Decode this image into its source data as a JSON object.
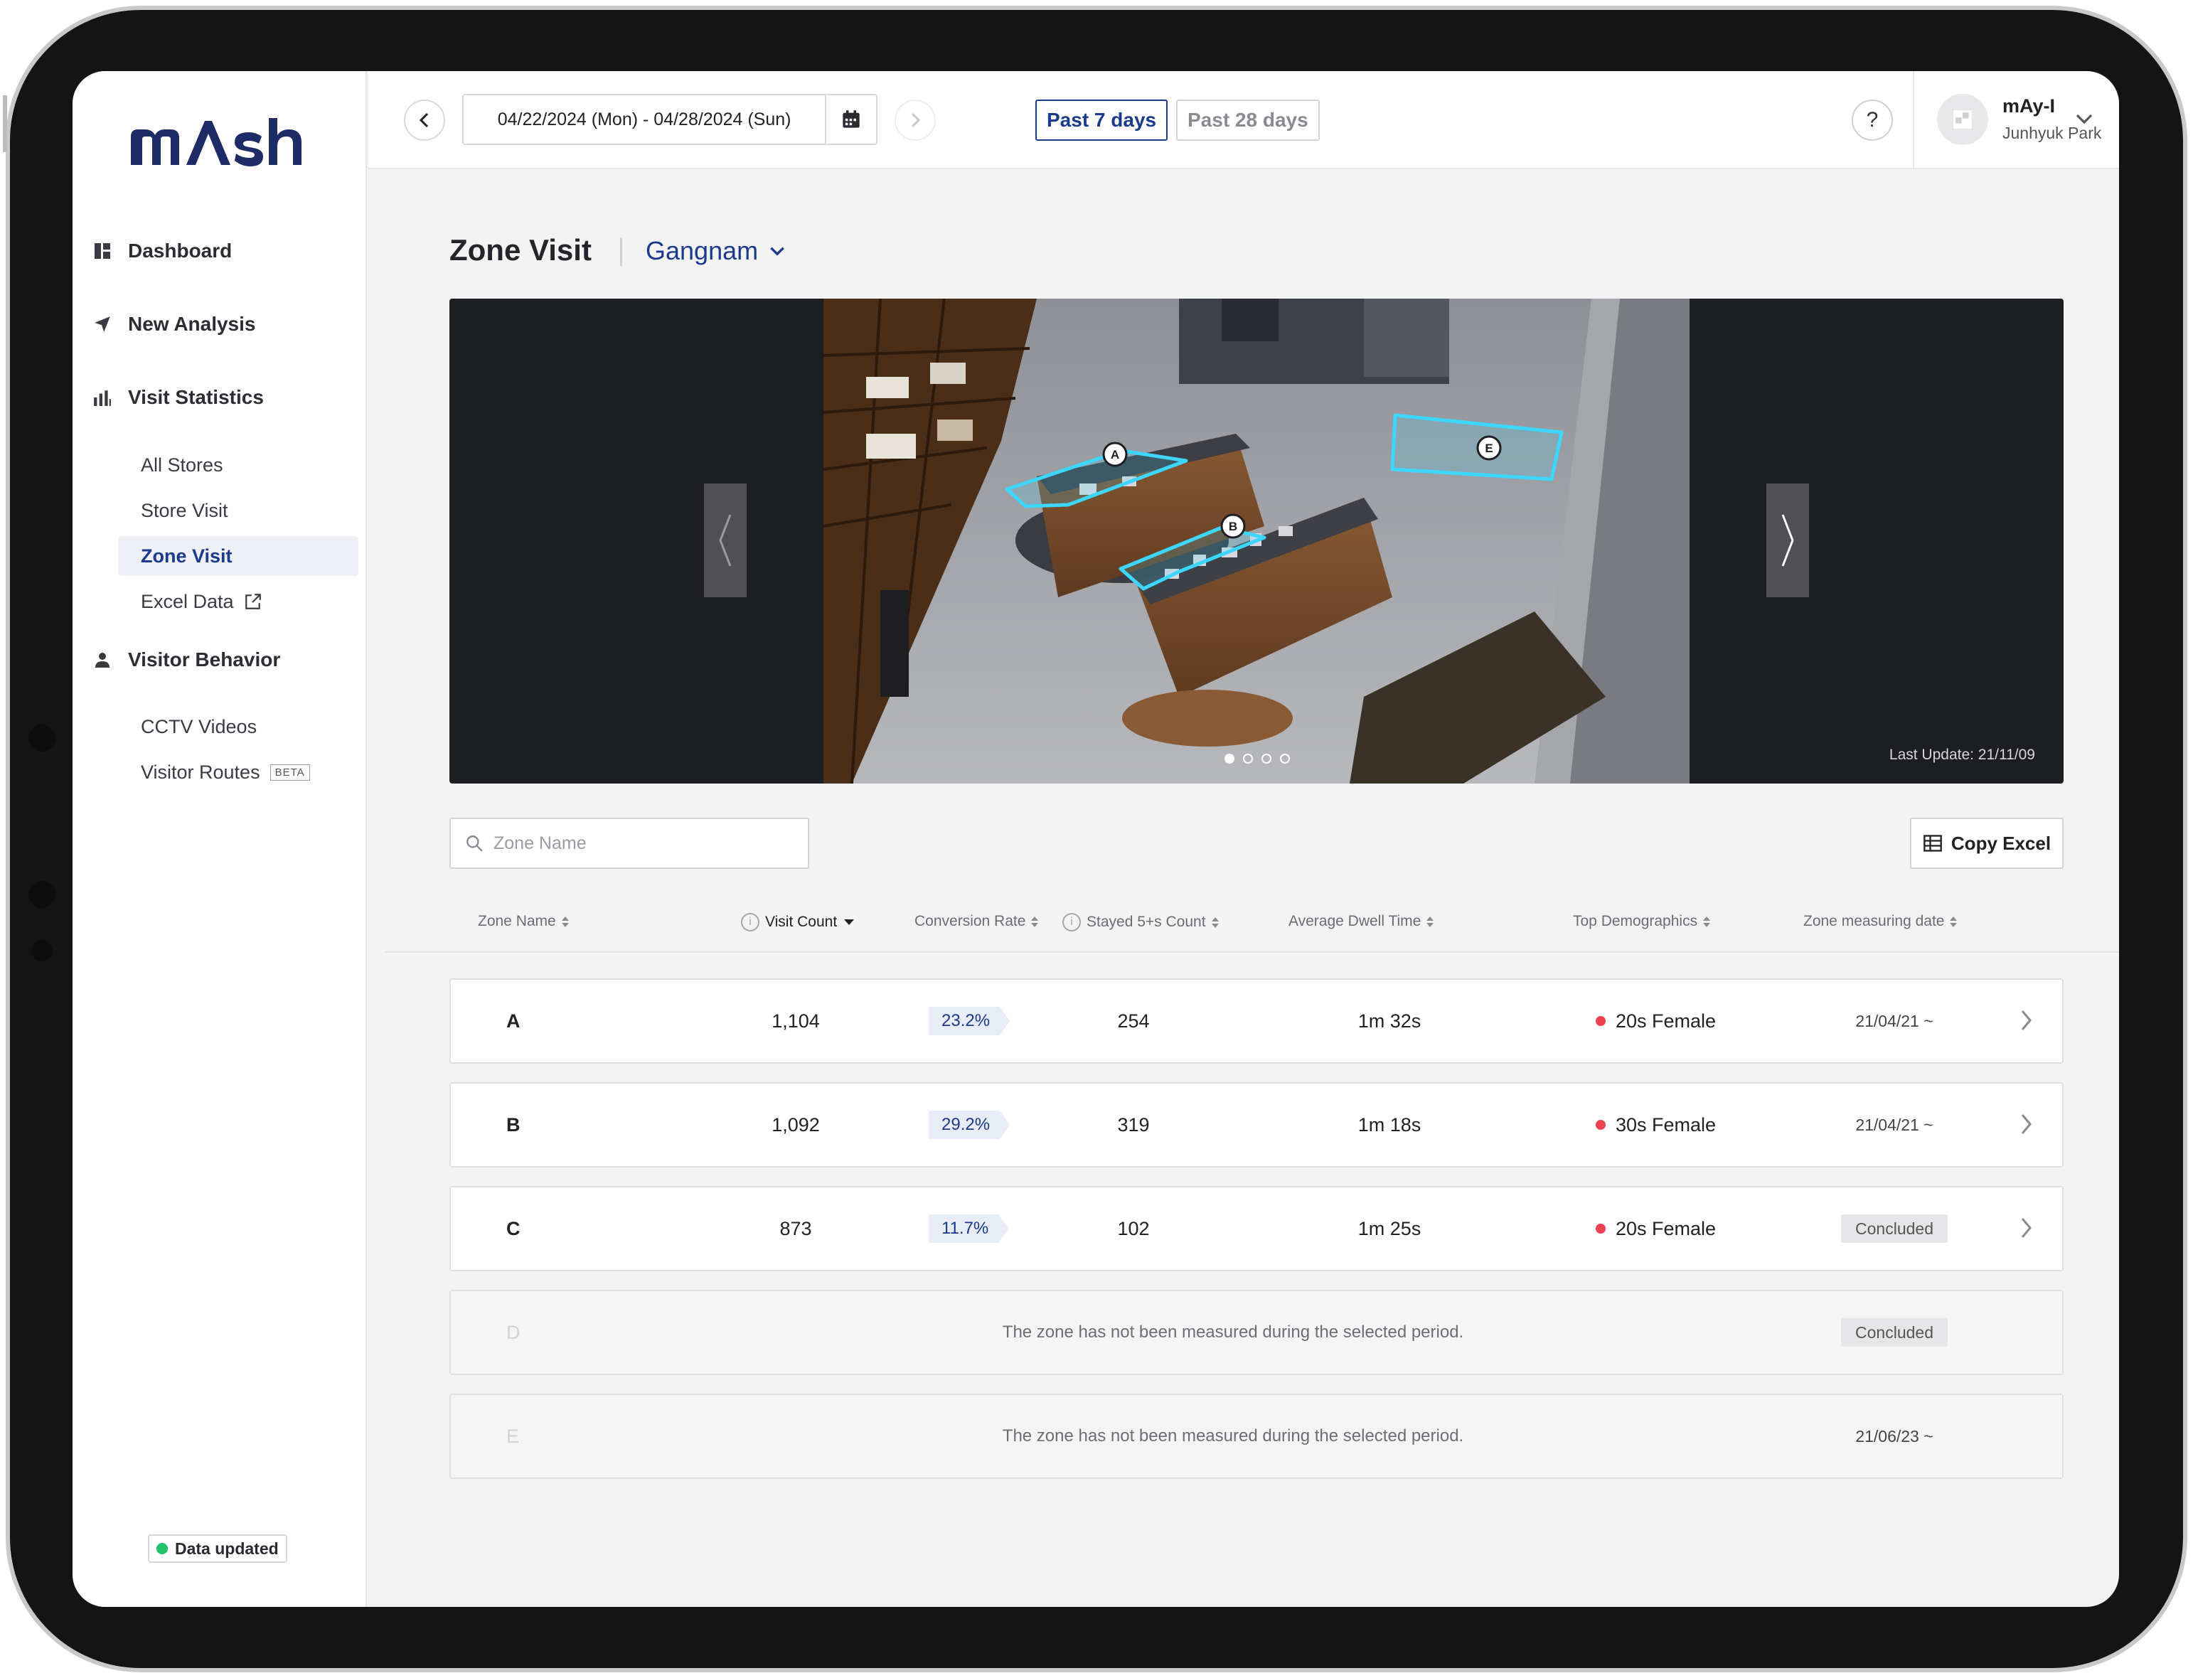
{
  "brand": {
    "logo_text": "mAsh"
  },
  "sidebar": {
    "main_items": [
      {
        "label": "Dashboard",
        "icon": "dashboard-icon"
      },
      {
        "label": "New Analysis",
        "icon": "send-icon"
      },
      {
        "label": "Visit Statistics",
        "icon": "bar-chart-icon"
      },
      {
        "label": "Visitor Behavior",
        "icon": "person-icon"
      }
    ],
    "sub_items": [
      {
        "label": "All Stores"
      },
      {
        "label": "Store Visit"
      },
      {
        "label": "Zone Visit",
        "active": true
      },
      {
        "label": "Excel Data",
        "icon": "external-link-icon"
      },
      {
        "label": "CCTV Videos"
      },
      {
        "label": "Visitor Routes",
        "badge": "BETA"
      }
    ],
    "status": "Data updated"
  },
  "topbar": {
    "date_range": "04/22/2024 (Mon) - 04/28/2024 (Sun)",
    "ranges": [
      {
        "label": "Past 7 days",
        "active": true
      },
      {
        "label": "Past 28 days",
        "active": false
      }
    ],
    "help": "?",
    "user": {
      "name": "mAy-I",
      "subtitle": "Junhyuk Park"
    }
  },
  "page": {
    "title": "Zone Visit",
    "store": "Gangnam"
  },
  "viewer": {
    "last_update": "Last Update: 21/11/09",
    "pages": 4,
    "current_page": 1,
    "zone_markers": [
      "A",
      "B",
      "E"
    ]
  },
  "search": {
    "placeholder": "Zone Name"
  },
  "copy_excel": "Copy Excel",
  "table": {
    "headers": {
      "zone_name": "Zone Name",
      "visit_count": "Visit Count",
      "conversion_rate": "Conversion Rate",
      "stayed": "Stayed 5+s Count",
      "dwell": "Average Dwell Time",
      "demographics": "Top Demographics",
      "measuring_date": "Zone measuring date"
    },
    "rows": [
      {
        "zone": "A",
        "visits": "1,104",
        "rate": "23.2%",
        "stayed": "254",
        "dwell": "1m 32s",
        "demo": "20s Female",
        "date": "21/04/21 ~"
      },
      {
        "zone": "B",
        "visits": "1,092",
        "rate": "29.2%",
        "stayed": "319",
        "dwell": "1m 18s",
        "demo": "30s Female",
        "date": "21/04/21 ~"
      },
      {
        "zone": "C",
        "visits": "873",
        "rate": "11.7%",
        "stayed": "102",
        "dwell": "1m 25s",
        "demo": "20s Female",
        "status": "Concluded"
      }
    ],
    "unmeasured_rows": [
      {
        "zone": "D",
        "message": "The zone has not been measured during the selected period.",
        "status": "Concluded"
      },
      {
        "zone": "E",
        "message": "The zone has not been measured during the selected period.",
        "date": "21/06/23 ~"
      }
    ]
  },
  "colors": {
    "accent": "#1b3a8a",
    "demo_dot": "#ef4052",
    "updated_dot": "#1fc46b",
    "zone_outline": "#3cd6ff"
  }
}
